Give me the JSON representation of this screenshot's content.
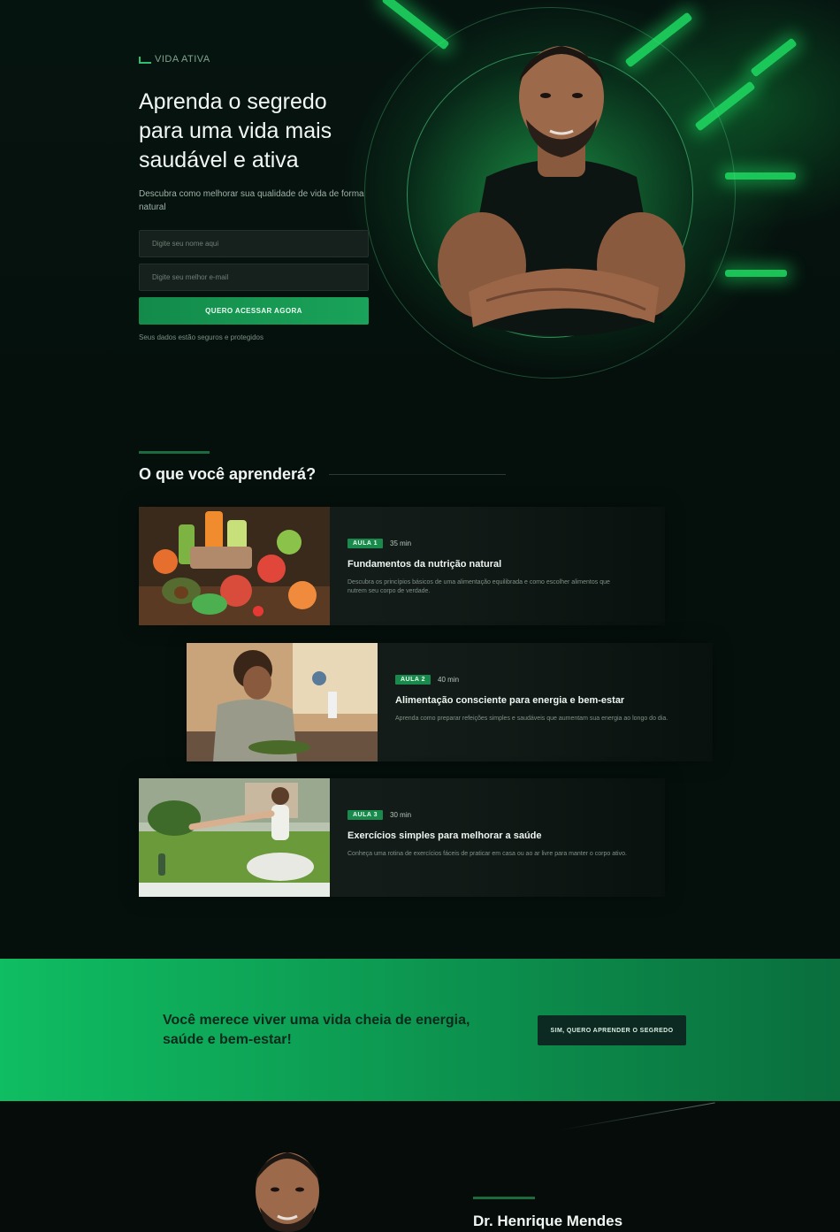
{
  "brand": {
    "name": "VIDA ATIVA"
  },
  "hero": {
    "title": "Aprenda o segredo para uma vida mais saudável e ativa",
    "subtitle": "Descubra como melhorar sua qualidade de vida de forma natural",
    "name_placeholder": "Digite seu nome aqui",
    "email_placeholder": "Digite seu melhor e-mail",
    "cta_label": "QUERO ACESSAR AGORA",
    "note": "Seus dados estão seguros e protegidos"
  },
  "learn": {
    "title": "O que você aprenderá?",
    "lessons": [
      {
        "badge": "AULA 1",
        "duration": "35 min",
        "title": "Fundamentos da nutrição natural",
        "description": "Descubra os princípios básicos de uma alimentação equilibrada e como escolher alimentos que nutrem seu corpo de verdade."
      },
      {
        "badge": "AULA 2",
        "duration": "40 min",
        "title": "Alimentação consciente para energia e bem-estar",
        "description": "Aprenda como preparar refeições simples e saudáveis que aumentam sua energia ao longo do dia."
      },
      {
        "badge": "AULA 3",
        "duration": "30 min",
        "title": "Exercícios simples para melhorar a saúde",
        "description": "Conheça uma rotina de exercícios fáceis de praticar em casa ou ao ar livre para manter o corpo ativo."
      }
    ]
  },
  "band": {
    "text": "Você merece viver uma vida cheia de energia, saúde e bem-estar!",
    "button_label": "SIM, QUERO APRENDER O SEGREDO"
  },
  "instructor": {
    "name": "Dr. Henrique Mendes"
  },
  "colors": {
    "accent": "#1aa35a",
    "background": "#05100c",
    "band": "#0fbd62"
  }
}
